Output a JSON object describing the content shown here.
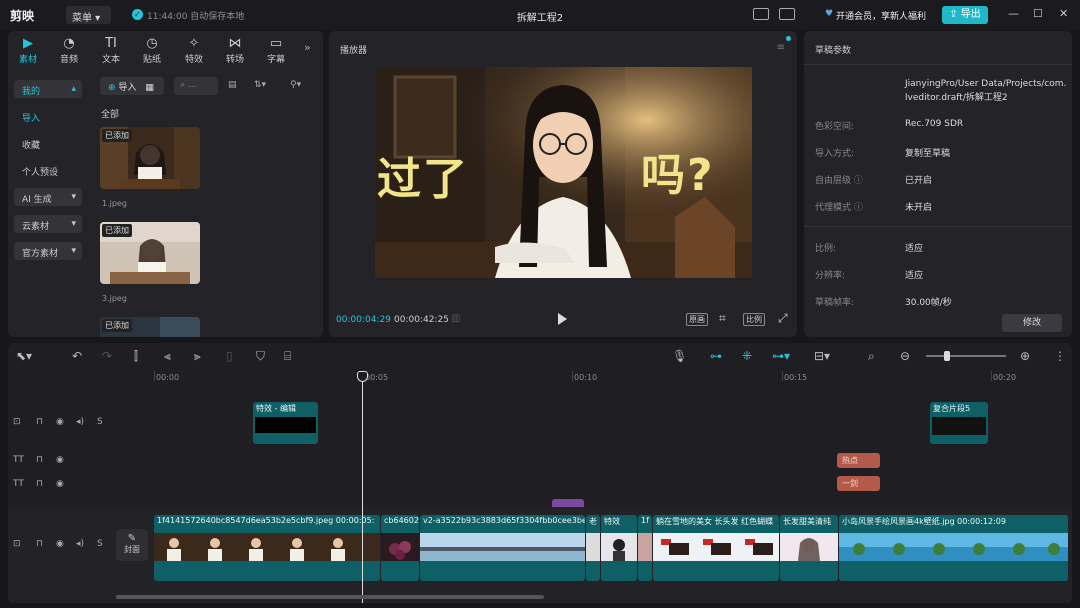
{
  "app": {
    "logo": "剪映",
    "menu_label": "菜单",
    "save_status": "11:44:00 自动保存本地",
    "project_title": "拆解工程2",
    "vip_text": "开通会员，享新人福利",
    "export_label": "导出"
  },
  "left_panel": {
    "tabs": [
      {
        "icon": "media-icon",
        "label": "素材"
      },
      {
        "icon": "audio-icon",
        "label": "音频"
      },
      {
        "icon": "text-icon",
        "label": "文本"
      },
      {
        "icon": "sticker-icon",
        "label": "贴纸"
      },
      {
        "icon": "effects-icon",
        "label": "特效"
      },
      {
        "icon": "transition-icon",
        "label": "转场"
      },
      {
        "icon": "caption-icon",
        "label": "字幕"
      }
    ],
    "nav": {
      "mine": "我的",
      "import": "导入",
      "favorites": "收藏",
      "presets": "个人预设",
      "ai": "AI 生成",
      "cloud": "云素材",
      "official": "官方素材"
    },
    "import_button": "导入",
    "search_placeholder": "...",
    "section_all": "全部",
    "media": [
      {
        "badge": "已添加",
        "name": "1.jpeg"
      },
      {
        "badge": "已添加",
        "name": "3.jpeg"
      },
      {
        "badge": "已添加",
        "name": ""
      }
    ]
  },
  "player": {
    "title": "播放器",
    "overlay_left": "过了",
    "overlay_right": "吗?",
    "time_current": "00:00:04:29",
    "time_total": "00:00:42:25",
    "ctrl_original": "原画",
    "ctrl_ratio": "比例"
  },
  "props": {
    "title": "草稿参数",
    "path": "JianyingPro/User Data/Projects/com.lveditor.draft/拆解工程2",
    "rows": [
      {
        "label": "色彩空间:",
        "value": "Rec.709 SDR"
      },
      {
        "label": "导入方式:",
        "value": "复制至草稿"
      },
      {
        "label": "自由层级",
        "value": "已开启"
      },
      {
        "label": "代理模式",
        "value": "未开启"
      },
      {
        "label": "比例:",
        "value": "适应"
      },
      {
        "label": "分辨率:",
        "value": "适应"
      },
      {
        "label": "草稿帧率:",
        "value": "30.00帧/秒"
      }
    ],
    "edit_button": "修改"
  },
  "timeline": {
    "ruler": [
      "00:00",
      "00:05",
      "00:10",
      "00:15",
      "00:20"
    ],
    "effect_clip": "特效 - 编辑",
    "compound_clip": "复合片段5",
    "text_clips": [
      "热点",
      "一剑"
    ],
    "cover_label": "封面",
    "main_clips": [
      {
        "name": "1f4141572640bc8547d6ea53b2e5cbf9.jpeg  00:00:05:"
      },
      {
        "name": "cb64602"
      },
      {
        "name": "v2-a3522b93c3883d65f3304fbb0cee3be"
      },
      {
        "name": "老"
      },
      {
        "name": "特效"
      },
      {
        "name": "1f"
      },
      {
        "name": "躺在雪地的美女 长头发 红色蝴蝶"
      },
      {
        "name": "长发甜美清纯"
      },
      {
        "name": "小岛风景手绘风景画4k壁纸.jpg  00:00:12:09"
      }
    ]
  },
  "colors": {
    "accent": "#26c6da",
    "clip": "#0f5f66",
    "text_clip": "#b35a4a"
  }
}
